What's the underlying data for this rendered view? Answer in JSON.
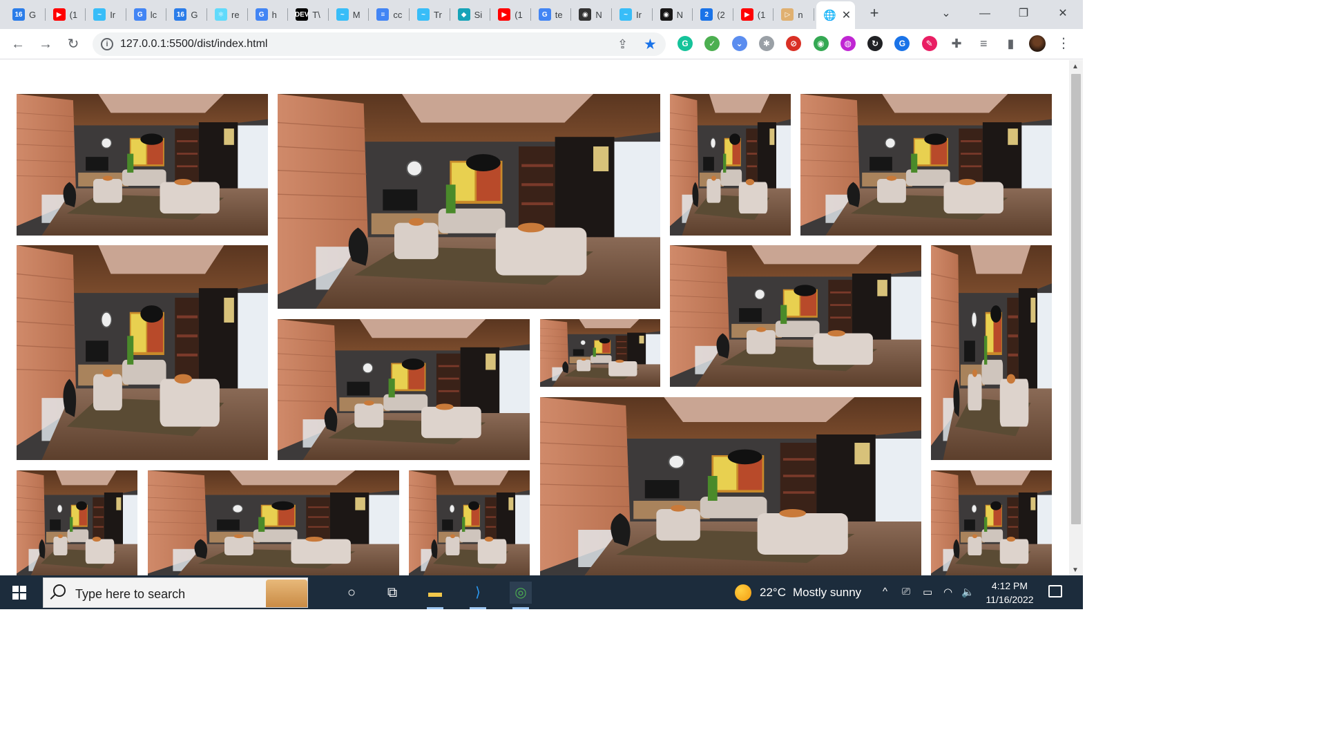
{
  "browser": {
    "tabs": [
      {
        "favicon": "16",
        "title": "G",
        "color": "#2b7de9"
      },
      {
        "favicon": "▶",
        "title": "(1",
        "color": "#ff0000"
      },
      {
        "favicon": "~",
        "title": "Ir",
        "color": "#38bdf8"
      },
      {
        "favicon": "G",
        "title": "lc",
        "color": "#4285f4"
      },
      {
        "favicon": "16",
        "title": "G",
        "color": "#2b7de9"
      },
      {
        "favicon": "⚛",
        "title": "re",
        "color": "#61dafb"
      },
      {
        "favicon": "G",
        "title": "h",
        "color": "#4285f4"
      },
      {
        "favicon": "DEV",
        "title": "T\\",
        "color": "#000000"
      },
      {
        "favicon": "~",
        "title": "M",
        "color": "#38bdf8"
      },
      {
        "favicon": "≡",
        "title": "cc",
        "color": "#4285f4"
      },
      {
        "favicon": "~",
        "title": "Tr",
        "color": "#38bdf8"
      },
      {
        "favicon": "◆",
        "title": "Si",
        "color": "#16a3b8"
      },
      {
        "favicon": "▶",
        "title": "(1",
        "color": "#ff0000"
      },
      {
        "favicon": "G",
        "title": "te",
        "color": "#4285f4"
      },
      {
        "favicon": "◉",
        "title": "N",
        "color": "#333333"
      },
      {
        "favicon": "~",
        "title": "Ir",
        "color": "#38bdf8"
      },
      {
        "favicon": "◉",
        "title": "N",
        "color": "#181717"
      },
      {
        "favicon": "2",
        "title": "(2",
        "color": "#1a73e8"
      },
      {
        "favicon": "▶",
        "title": "(1",
        "color": "#ff0000"
      },
      {
        "favicon": "▷",
        "title": "n",
        "color": "#e0b070"
      }
    ],
    "active_tab": {
      "favicon": "🌐",
      "close": "✕"
    },
    "new_tab": "+",
    "window_controls": {
      "dropdown": "⌄",
      "minimize": "—",
      "restore": "❐",
      "close": "✕"
    },
    "nav": {
      "back": "←",
      "forward": "→",
      "reload": "↻"
    },
    "url": "127.0.0.1:5500/dist/index.html",
    "omnibox_icons": {
      "info": "i",
      "share": "⇪",
      "bookmark": "★"
    },
    "extensions": [
      {
        "name": "grammarly-icon",
        "glyph": "G",
        "color": "#15c39a"
      },
      {
        "name": "spellcheck-icon",
        "glyph": "✓",
        "color": "#4caf50"
      },
      {
        "name": "bookmark-ext-icon",
        "glyph": "⌄",
        "color": "#5b8def"
      },
      {
        "name": "gear-ext-icon",
        "glyph": "✱",
        "color": "#9aa0a6"
      },
      {
        "name": "block-icon",
        "glyph": "⊘",
        "color": "#d93025"
      },
      {
        "name": "android-icon",
        "glyph": "◉",
        "color": "#34a853"
      },
      {
        "name": "pink-ext-icon",
        "glyph": "◍",
        "color": "#c026d3"
      },
      {
        "name": "sync-icon",
        "glyph": "↻",
        "color": "#202124"
      },
      {
        "name": "grammar-icon",
        "glyph": "G",
        "color": "#1a73e8"
      },
      {
        "name": "color-picker-icon",
        "glyph": "✎",
        "color": "#e91e63"
      },
      {
        "name": "puzzle-icon",
        "glyph": "✚",
        "color": "#5f6368"
      },
      {
        "name": "media-icon",
        "glyph": "≡",
        "color": "#5f6368"
      },
      {
        "name": "sidepanel-icon",
        "glyph": "▮",
        "color": "#5f6368"
      }
    ],
    "menu": "⋮"
  },
  "scrollbar": {
    "up": "▲",
    "down": "▼"
  },
  "taskbar": {
    "search_placeholder": "Type here to search",
    "apps": [
      {
        "name": "cortana-icon",
        "glyph": "○"
      },
      {
        "name": "task-view-icon",
        "glyph": "⧉"
      },
      {
        "name": "file-explorer-icon",
        "glyph": "▬"
      },
      {
        "name": "vscode-icon",
        "glyph": "⟩"
      },
      {
        "name": "chrome-icon",
        "glyph": "◎"
      }
    ],
    "weather": {
      "temp": "22°C",
      "condition": "Mostly sunny"
    },
    "tray": {
      "chevron": "^",
      "meet": "⎚",
      "battery": "▭",
      "wifi": "◠",
      "volume": "🔈"
    },
    "time": "4:12 PM",
    "date": "11/16/2022"
  }
}
